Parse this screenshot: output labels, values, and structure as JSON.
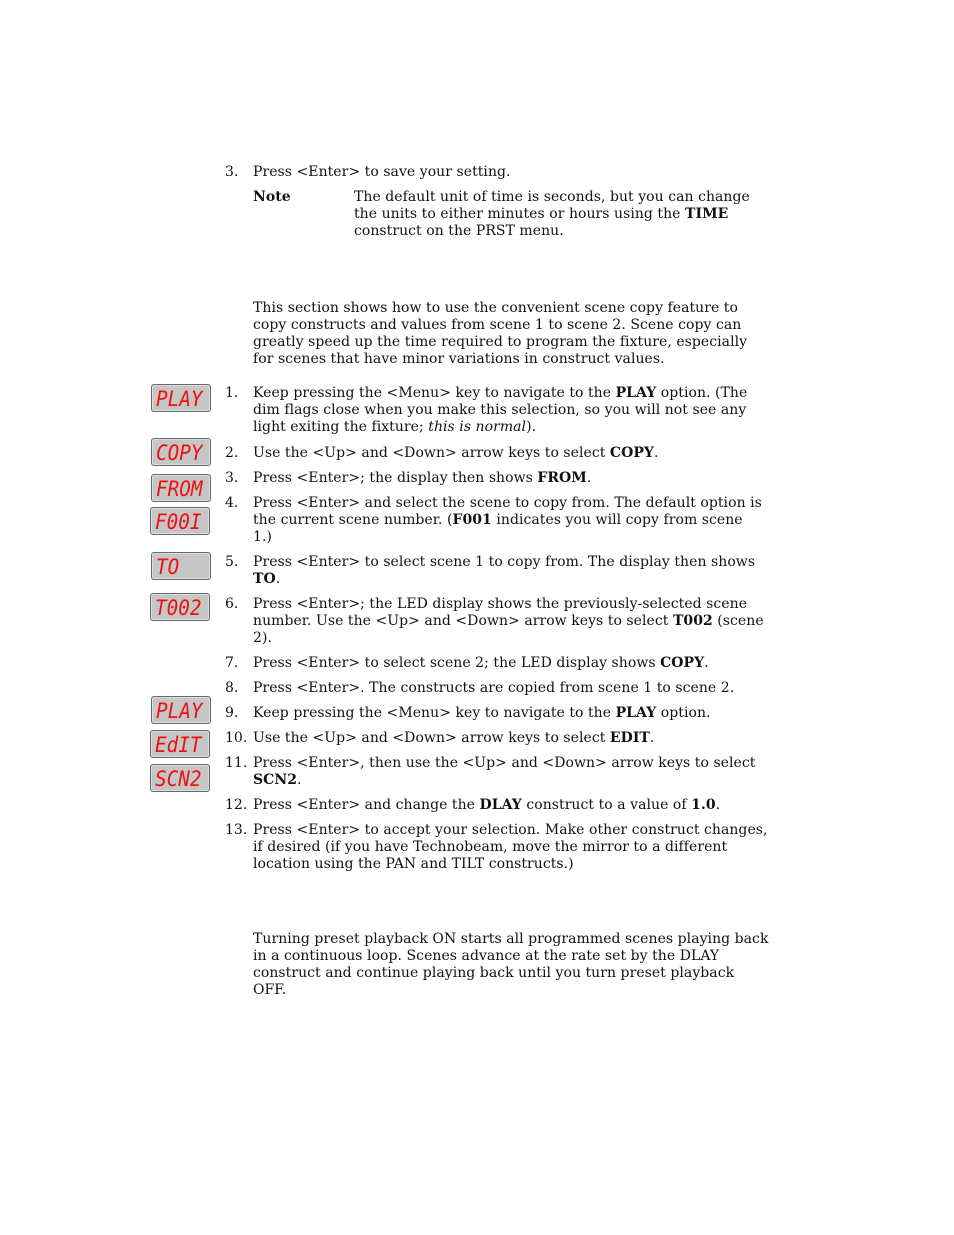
{
  "top_step": {
    "number": "3.",
    "text": "Press <Enter> to save your setting."
  },
  "note": {
    "label": "Note",
    "lines": [
      [
        "The default unit of time is seconds, but you can change"
      ],
      [
        "the units to either minutes or hours using the ",
        "TIME"
      ],
      [
        "construct on the PRST menu."
      ]
    ]
  },
  "scene_copy_intro": [
    "This section shows how to use the convenient scene copy feature to",
    "copy constructs and values from scene 1 to scene 2.  Scene copy can",
    "greatly speed up the time required to program the fixture, especially",
    "for scenes that have minor variations in construct values."
  ],
  "led_displays": [
    "PLAY",
    "COPY",
    "FROM",
    "F00I",
    "TO",
    "T002",
    "PLAY",
    "EdIT",
    "SCN2"
  ],
  "steps": [
    {
      "number": "1.",
      "lines": [
        [
          {
            "t": "Keep pressing the <Menu> key to navigate to the "
          },
          {
            "t": "PLAY",
            "b": true
          },
          {
            "t": " option.  (The"
          }
        ],
        [
          {
            "t": "dim flags close when you make this selection, so you will not see any"
          }
        ],
        [
          {
            "t": "light exiting the fixture; "
          },
          {
            "t": "this is normal",
            "i": true
          },
          {
            "t": ")."
          }
        ]
      ]
    },
    {
      "number": "2.",
      "lines": [
        [
          {
            "t": "Use the <Up> and <Down> arrow keys to select "
          },
          {
            "t": "COPY",
            "b": true
          },
          {
            "t": "."
          }
        ]
      ]
    },
    {
      "number": "3.",
      "lines": [
        [
          {
            "t": "Press <Enter>; the display then shows "
          },
          {
            "t": "FROM",
            "b": true
          },
          {
            "t": "."
          }
        ]
      ]
    },
    {
      "number": "4.",
      "lines": [
        [
          {
            "t": "Press <Enter> and select the scene to copy from.  The default option is"
          }
        ],
        [
          {
            "t": "the current scene number.  ("
          },
          {
            "t": "F001",
            "b": true
          },
          {
            "t": " indicates you will copy from scene"
          }
        ],
        [
          {
            "t": "1.)"
          }
        ]
      ]
    },
    {
      "number": "5.",
      "lines": [
        [
          {
            "t": "Press <Enter> to select scene 1 to copy from.  The display then shows"
          }
        ],
        [
          {
            "t": "TO",
            "b": true
          },
          {
            "t": "."
          }
        ]
      ]
    },
    {
      "number": "6.",
      "lines": [
        [
          {
            "t": "Press <Enter>; the LED display shows the previously-selected scene"
          }
        ],
        [
          {
            "t": "number.  Use the <Up> and <Down> arrow keys to select "
          },
          {
            "t": "T002",
            "b": true
          },
          {
            "t": " (scene"
          }
        ],
        [
          {
            "t": "2)."
          }
        ]
      ]
    },
    {
      "number": "7.",
      "lines": [
        [
          {
            "t": "Press <Enter> to select scene 2; the LED display shows "
          },
          {
            "t": "COPY",
            "b": true
          },
          {
            "t": "."
          }
        ]
      ]
    },
    {
      "number": "8.",
      "lines": [
        [
          {
            "t": "Press <Enter>.  The constructs are copied from scene 1 to scene 2."
          }
        ]
      ]
    },
    {
      "number": "9.",
      "lines": [
        [
          {
            "t": "Keep pressing the <Menu> key to navigate to the "
          },
          {
            "t": "PLAY",
            "b": true
          },
          {
            "t": " option."
          }
        ]
      ]
    },
    {
      "number": "10.",
      "lines": [
        [
          {
            "t": "Use the <Up> and <Down> arrow keys to select "
          },
          {
            "t": "EDIT",
            "b": true
          },
          {
            "t": "."
          }
        ]
      ]
    },
    {
      "number": "11.",
      "lines": [
        [
          {
            "t": "Press <Enter>, then use the <Up> and <Down> arrow keys to select"
          }
        ],
        [
          {
            "t": "SCN2",
            "b": true
          },
          {
            "t": "."
          }
        ]
      ]
    },
    {
      "number": "12.",
      "lines": [
        [
          {
            "t": "Press <Enter> and change the "
          },
          {
            "t": "DLAY",
            "b": true
          },
          {
            "t": " construct to a value of "
          },
          {
            "t": "1.0",
            "b": true
          },
          {
            "t": "."
          }
        ]
      ]
    },
    {
      "number": "13.",
      "lines": [
        [
          {
            "t": "Press <Enter> to accept your selection.  Make other construct changes,"
          }
        ],
        [
          {
            "t": "if desired (if you have Technobeam, move the mirror to a different"
          }
        ],
        [
          {
            "t": "location using the PAN and TILT constructs.)"
          }
        ]
      ]
    }
  ],
  "playback_intro": [
    "Turning preset playback ON starts all programmed scenes playing back",
    "in a continuous loop.  Scenes advance at the rate set by the DLAY",
    "construct and continue playing back until you turn preset playback",
    "OFF."
  ],
  "colors": {
    "led_text": "#ee1111",
    "led_background": "#c6c6c6"
  }
}
